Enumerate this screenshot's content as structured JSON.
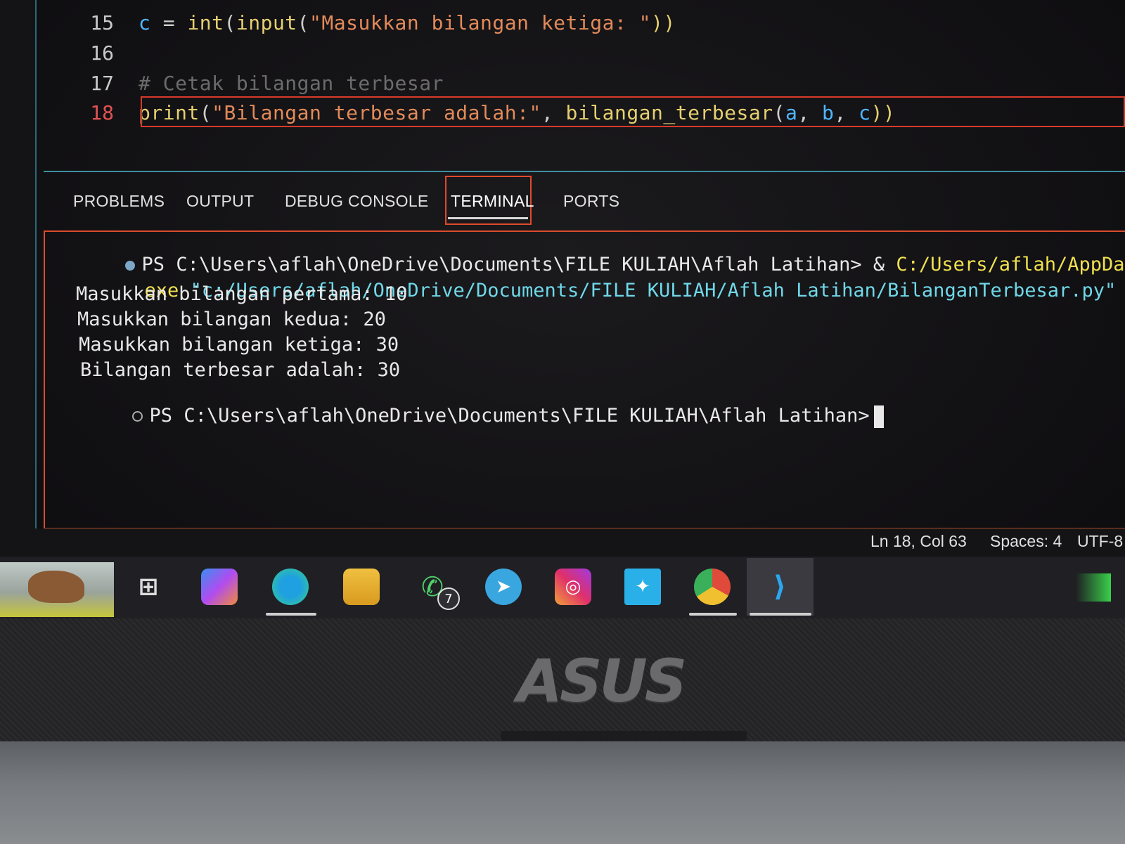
{
  "editor": {
    "lines": [
      {
        "num": "15",
        "parts": [
          {
            "text": "c",
            "cls": "kw-var"
          },
          {
            "text": " = ",
            "cls": "op"
          },
          {
            "text": "int",
            "cls": "fn"
          },
          {
            "text": "(",
            "cls": "op"
          },
          {
            "text": "input",
            "cls": "fn"
          },
          {
            "text": "(",
            "cls": "op"
          },
          {
            "text": "\"Masukkan bilangan ketiga: \"",
            "cls": "str"
          },
          {
            "text": "))",
            "cls": "fn"
          }
        ]
      },
      {
        "num": "16",
        "parts": []
      },
      {
        "num": "17",
        "parts": [
          {
            "text": "# Cetak bilangan terbesar",
            "cls": "comment"
          }
        ]
      },
      {
        "num": "18",
        "parts": [
          {
            "text": "print",
            "cls": "fn"
          },
          {
            "text": "(",
            "cls": "op"
          },
          {
            "text": "\"Bilangan terbesar adalah:\"",
            "cls": "str"
          },
          {
            "text": ", ",
            "cls": "op"
          },
          {
            "text": "bilangan_terbesar",
            "cls": "fn"
          },
          {
            "text": "(",
            "cls": "op"
          },
          {
            "text": "a",
            "cls": "kw-var"
          },
          {
            "text": ", ",
            "cls": "op"
          },
          {
            "text": "b",
            "cls": "kw-var"
          },
          {
            "text": ", ",
            "cls": "op"
          },
          {
            "text": "c",
            "cls": "kw-var"
          },
          {
            "text": "))",
            "cls": "fn"
          }
        ]
      }
    ]
  },
  "panel": {
    "tabs": [
      {
        "label": "PROBLEMS"
      },
      {
        "label": "OUTPUT"
      },
      {
        "label": "DEBUG CONSOLE"
      },
      {
        "label": "TERMINAL"
      },
      {
        "label": "PORTS"
      }
    ]
  },
  "terminal": {
    "cmd_prompt": "PS C:\\Users\\aflah\\OneDrive\\Documents\\FILE KULIAH\\Aflah Latihan> & ",
    "cmd_exe_path": "C:/Users/aflah/AppData/Local/Micro",
    "cmd_exe_tail": "exe",
    "cmd_script": " \"c:/Users/aflah/OneDrive/Documents/FILE KULIAH/Aflah Latihan/BilanganTerbesar.py\"",
    "out1": "Masukkan bilangan pertama: 10",
    "out2": "Masukkan bilangan kedua: 20",
    "out3": "Masukkan bilangan ketiga: 30",
    "out4": "Bilangan terbesar adalah: 30",
    "final_prompt": "PS C:\\Users\\aflah\\OneDrive\\Documents\\FILE KULIAH\\Aflah Latihan>"
  },
  "status": {
    "position": "Ln 18, Col 63",
    "spaces": "Spaces: 4",
    "encoding": "UTF-8"
  },
  "taskbar": {
    "whatsapp_badge": "7",
    "logo": "ASUS"
  }
}
